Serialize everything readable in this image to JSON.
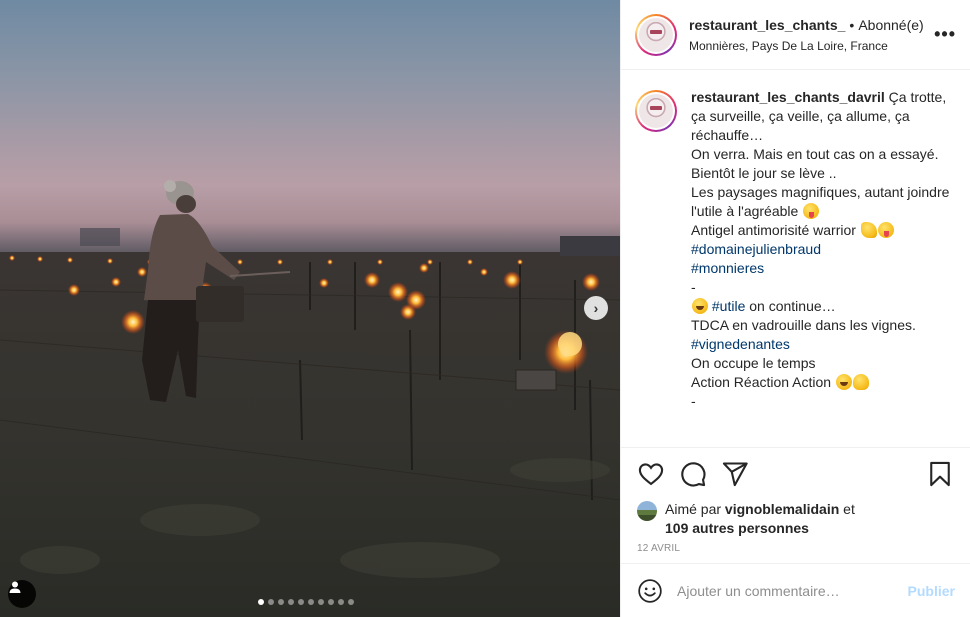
{
  "post": {
    "photo_alt": "",
    "carousel": {
      "total": 10,
      "active_index": 0
    }
  },
  "header": {
    "username": "restaurant_les_chants_",
    "separator": "•",
    "follow_status": "Abonné(e)",
    "location": "Monnières, Pays De La Loire, France",
    "more": "•••"
  },
  "caption": {
    "username": "restaurant_les_chants_davril",
    "lines": [
      "Ça trotte, ça surveille, ça veille, ça allume, ça réchauffe…",
      "On verra. Mais en tout cas on a essayé.",
      "Bientôt le jour se lève ..",
      "Les paysages magnifiques, autant joindre l'utile à l'agréable",
      "Antigel antimorisité warrior",
      "#domainejulienbraud",
      "#monnieres",
      "-",
      "#utile",
      "on continue…",
      "TDCA en vadrouille dans les vignes.",
      "#vignedenantes",
      "On occupe le temps",
      "Action Réaction Action",
      "-"
    ]
  },
  "likes": {
    "prefix": "Aimé par",
    "user": "vignoblemalidain",
    "joiner": "et",
    "others": "109 autres personnes"
  },
  "date": "12 AVRIL",
  "comment": {
    "placeholder": "Ajouter un commentaire…",
    "publish_label": "Publier"
  },
  "colors": {
    "hashtag": "#00376b",
    "publish_disabled": "#b3dbff",
    "muted": "#8e8e8e"
  }
}
